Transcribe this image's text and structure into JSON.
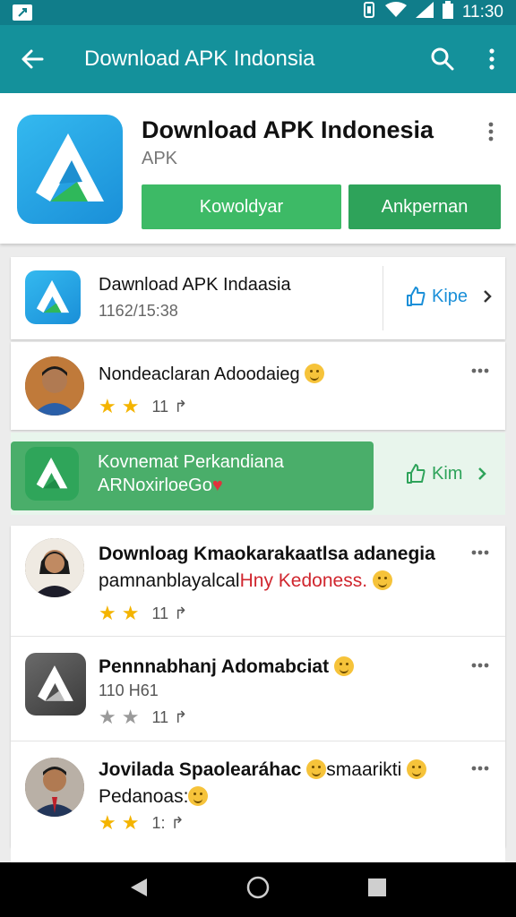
{
  "status_bar": {
    "time": "11:30"
  },
  "app_bar": {
    "title": "Download APK Indonsia"
  },
  "header": {
    "title": "Download APK Indonesia",
    "subtitle": "APK",
    "primary_button": "Kowoldyar",
    "secondary_button": "Ankpernan"
  },
  "featured": {
    "title": "Dawnload APK Indaasia",
    "subtitle": "1162/15:38",
    "action": "Kipe"
  },
  "highlight": {
    "title": "Kovnemat Perkandiana",
    "subtitle": "ARNoxirloeGo",
    "action": "Kim"
  },
  "rows": [
    {
      "title": "Nondeaclaran Adoodaieg",
      "count": "11",
      "stars_gold": 2,
      "stars_total": 2
    },
    {
      "title": "Downloag Kmaokarakaatlsa adanegia",
      "title2_prefix": "pamnanblayalcal",
      "title2_red": "Hny Kedoness.",
      "count": "11",
      "stars_gold": 2,
      "stars_total": 2
    },
    {
      "title": "Pennnabhanj Adomabciat",
      "subtitle": "110 H61",
      "count": "11",
      "stars_gold": 0,
      "stars_total": 2
    },
    {
      "title": "Jovilada Spaolearáhac",
      "title_suffix": "smaarikti",
      "title2": "Pedanoas:",
      "count": "1:",
      "stars_gold": 2,
      "stars_total": 2
    }
  ],
  "colors": {
    "app_bar": "#14919b",
    "status_bar": "#107d8a",
    "primary_green": "#3dba66",
    "highlight_green": "#4aae6a"
  }
}
